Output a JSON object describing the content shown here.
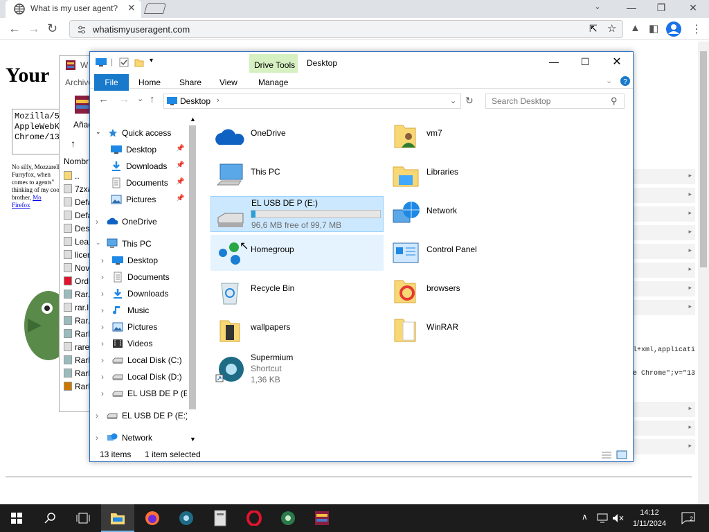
{
  "browser": {
    "tab_title": "What is my user agent?",
    "url": "whatismyuseragent.com"
  },
  "page": {
    "heading": "Your",
    "ua_lines": [
      "Mozilla/5",
      "AppleWebK",
      "Chrome/13"
    ],
    "body_text": "No silly, Mozzarella Furryfox, when comes to agents\" thinking of my cool brother,",
    "body_link": "Mo",
    "body_link2": "Firefox",
    "snippet1": "l+xml,applicati",
    "snippet2": "e Chrome\";v=\"13"
  },
  "winrar_bg": {
    "title": "W",
    "menu": "Archivo",
    "btn": "Añad",
    "col": "Nombr",
    "items": [
      "..",
      "7zxa",
      "Defa",
      "Defa",
      "Desc",
      "Lean",
      "licen",
      "Nove",
      "Ord",
      "Rar.",
      "rar.l",
      "Rar.t",
      "RarE",
      "rarex",
      "RarE",
      "RarE",
      "RarE"
    ]
  },
  "explorer": {
    "title": "Desktop",
    "drive_tools": "Drive Tools",
    "ribbon": {
      "file": "File",
      "home": "Home",
      "share": "Share",
      "view": "View",
      "manage": "Manage"
    },
    "address": "Desktop",
    "search_placeholder": "Search Desktop",
    "nav": {
      "quick_access": "Quick access",
      "qa_desktop": "Desktop",
      "qa_downloads": "Downloads",
      "qa_documents": "Documents",
      "qa_pictures": "Pictures",
      "onedrive": "OneDrive",
      "this_pc": "This PC",
      "pc_desktop": "Desktop",
      "pc_documents": "Documents",
      "pc_downloads": "Downloads",
      "pc_music": "Music",
      "pc_pictures": "Pictures",
      "pc_videos": "Videos",
      "pc_c": "Local Disk (C:)",
      "pc_d": "Local Disk (D:)",
      "pc_e": "EL USB DE P (E:)",
      "usb": "EL USB DE P (E:)",
      "network": "Network"
    },
    "items": {
      "onedrive": "OneDrive",
      "vm7": "vm7",
      "thispc": "This PC",
      "libraries": "Libraries",
      "usb_name": "EL USB DE P (E:)",
      "usb_free": "96,6 MB free of 99,7 MB",
      "usb_fill": 0.03,
      "network": "Network",
      "homegroup": "Homegroup",
      "controlpanel": "Control Panel",
      "recycle": "Recycle Bin",
      "browsers": "browsers",
      "wallpapers": "wallpapers",
      "winrar": "WinRAR",
      "supermium": "Supermium",
      "supermium_type": "Shortcut",
      "supermium_size": "1,36 KB"
    },
    "status": {
      "count": "13 items",
      "selected": "1 item selected"
    }
  },
  "taskbar": {
    "time": "14:12",
    "date": "1/11/2024",
    "notif": "2"
  }
}
